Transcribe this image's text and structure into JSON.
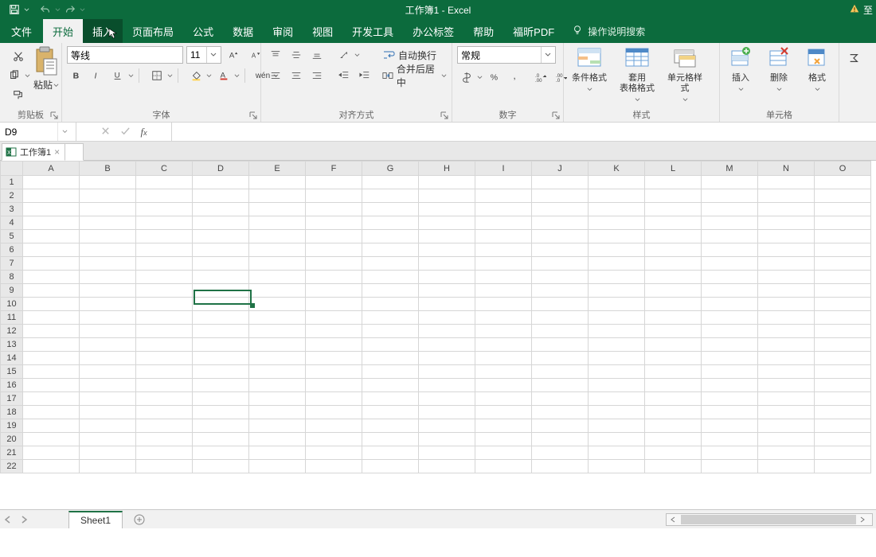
{
  "title": "工作簿1  -  Excel",
  "warn_suffix": "至",
  "tabs": {
    "file": "文件",
    "home": "开始",
    "insert": "插入",
    "layout": "页面布局",
    "formulas": "公式",
    "data": "数据",
    "review": "审阅",
    "view": "视图",
    "dev": "开发工具",
    "office": "办公标签",
    "help": "帮助",
    "foxit": "福昕PDF",
    "tell": "操作说明搜索"
  },
  "ribbon": {
    "clipboard": {
      "paste": "粘贴",
      "label": "剪贴板"
    },
    "font": {
      "name": "等线",
      "size": "11",
      "label": "字体",
      "phonetic": "wén"
    },
    "align": {
      "wrap": "自动换行",
      "merge": "合并后居中",
      "label": "对齐方式"
    },
    "number": {
      "format": "常规",
      "label": "数字"
    },
    "styles": {
      "cond": "条件格式",
      "table": "套用\n表格格式",
      "cell": "单元格样式",
      "label": "样式"
    },
    "cells": {
      "insert": "插入",
      "delete": "删除",
      "format": "格式",
      "label": "单元格"
    }
  },
  "namebox": "D9",
  "workbook_tab": "工作簿1",
  "columns": [
    "A",
    "B",
    "C",
    "D",
    "E",
    "F",
    "G",
    "H",
    "I",
    "J",
    "K",
    "L",
    "M",
    "N",
    "O"
  ],
  "rows": [
    "1",
    "2",
    "3",
    "4",
    "5",
    "6",
    "7",
    "8",
    "9",
    "10",
    "11",
    "12",
    "13",
    "14",
    "15",
    "16",
    "17",
    "18",
    "19",
    "20",
    "21",
    "22"
  ],
  "sheet_tab": "Sheet1",
  "selected_cell": "D9"
}
